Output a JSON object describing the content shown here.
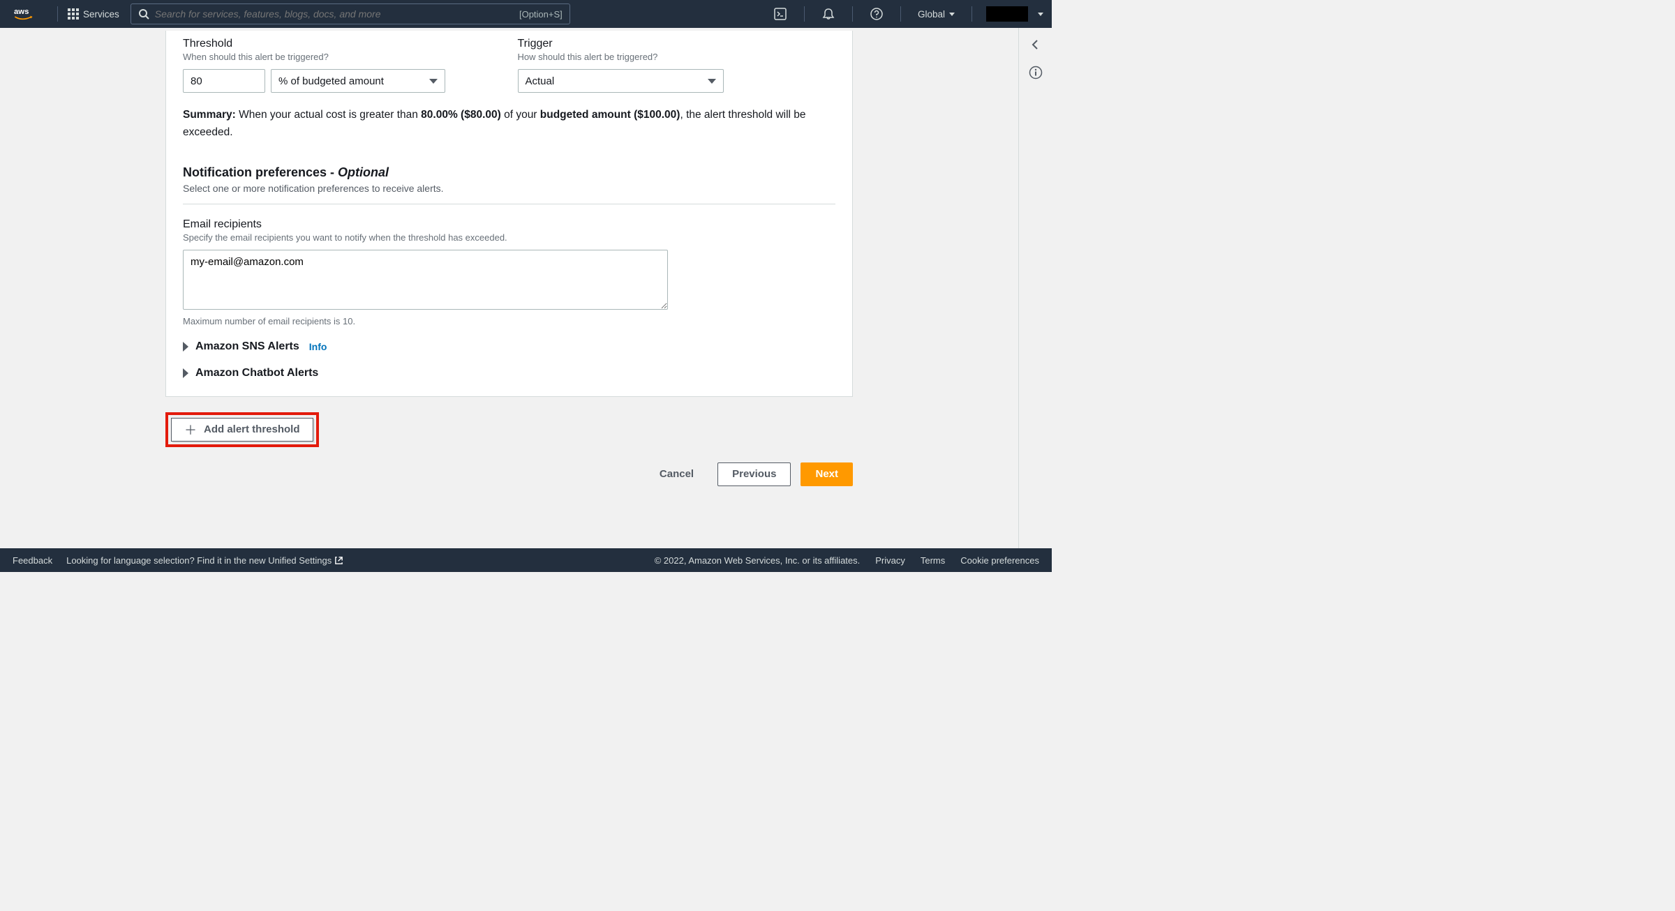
{
  "topnav": {
    "services_label": "Services",
    "search_placeholder": "Search for services, features, blogs, docs, and more",
    "search_shortcut": "[Option+S]",
    "region": "Global"
  },
  "threshold": {
    "label": "Threshold",
    "help": "When should this alert be triggered?",
    "value": "80",
    "unit_selected": "% of budgeted amount"
  },
  "trigger": {
    "label": "Trigger",
    "help": "How should this alert be triggered?",
    "selected": "Actual"
  },
  "summary": {
    "prefix": "Summary:",
    "t1": " When your actual cost is greater than ",
    "bold1": "80.00% ($80.00)",
    "t2": " of your ",
    "bold2": "budgeted amount ($100.00)",
    "t3": ", the alert threshold will be exceeded."
  },
  "prefs": {
    "heading_main": "Notification preferences - ",
    "heading_opt": "Optional",
    "desc": "Select one or more notification preferences to receive alerts."
  },
  "email": {
    "label": "Email recipients",
    "help": "Specify the email recipients you want to notify when the threshold has exceeded.",
    "value": "my-email@amazon.com",
    "hint": "Maximum number of email recipients is 10."
  },
  "expand": {
    "sns": "Amazon SNS Alerts",
    "sns_info": "Info",
    "chatbot": "Amazon Chatbot Alerts"
  },
  "add_button": "Add alert threshold",
  "buttons": {
    "cancel": "Cancel",
    "previous": "Previous",
    "next": "Next"
  },
  "footer": {
    "feedback": "Feedback",
    "lang_prefix": "Looking for language selection? Find it in the new ",
    "lang_link": "Unified Settings",
    "copyright": "© 2022, Amazon Web Services, Inc. or its affiliates.",
    "privacy": "Privacy",
    "terms": "Terms",
    "cookie": "Cookie preferences"
  }
}
